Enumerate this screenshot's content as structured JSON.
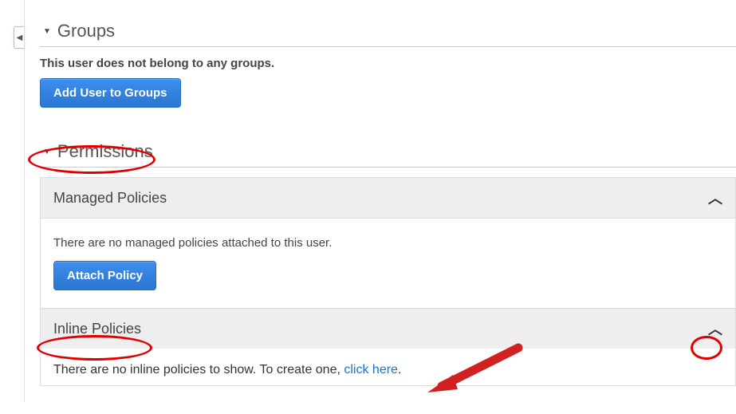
{
  "sections": {
    "groups": {
      "title": "Groups",
      "empty_text": "This user does not belong to any groups.",
      "add_button": "Add User to Groups"
    },
    "permissions": {
      "title": "Permissions",
      "managed": {
        "header": "Managed Policies",
        "empty_text": "There are no managed policies attached to this user.",
        "attach_button": "Attach Policy"
      },
      "inline": {
        "header": "Inline Policies",
        "empty_prefix": "There are no inline policies to show. To create one, ",
        "link_text": "click here",
        "suffix": "."
      }
    }
  }
}
